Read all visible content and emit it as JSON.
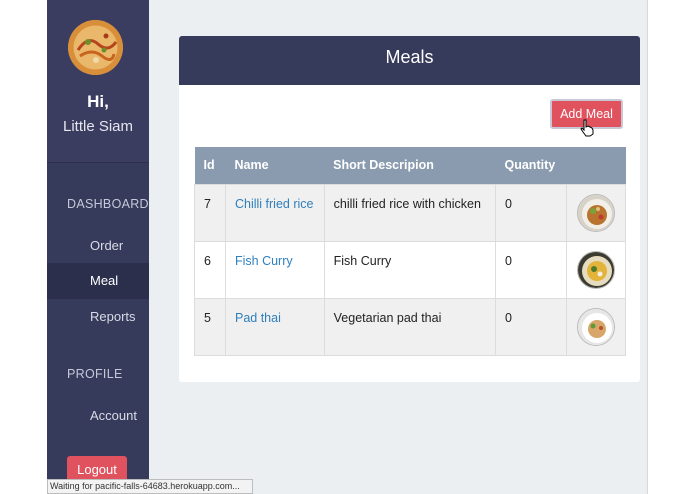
{
  "sidebar": {
    "greeting": "Hi,",
    "restaurant_name": "Little Siam",
    "section_dashboard": "DASHBOARD",
    "items": [
      {
        "label": "Order"
      },
      {
        "label": "Meal",
        "active": true
      },
      {
        "label": "Reports"
      }
    ],
    "section_profile": "PROFILE",
    "account_label": "Account",
    "logout_label": "Logout"
  },
  "card": {
    "title": "Meals",
    "add_button": "Add Meal"
  },
  "table": {
    "headers": [
      "Id",
      "Name",
      "Short Descripion",
      "Quantity",
      ""
    ],
    "rows": [
      {
        "id": "7",
        "name": "Chilli fried rice",
        "description": "chilli fried rice with chicken",
        "quantity": "0"
      },
      {
        "id": "6",
        "name": "Fish Curry",
        "description": "Fish Curry",
        "quantity": "0"
      },
      {
        "id": "5",
        "name": "Pad thai",
        "description": "Vegetarian pad thai",
        "quantity": "0"
      }
    ]
  },
  "status_bar": "Waiting for pacific-falls-64683.herokuapp.com...",
  "colors": {
    "sidebar": "#363a5b",
    "header": "#363a5b",
    "accent_red": "#e0525e",
    "link": "#2f7fbd",
    "table_header": "#8a9bb0"
  }
}
